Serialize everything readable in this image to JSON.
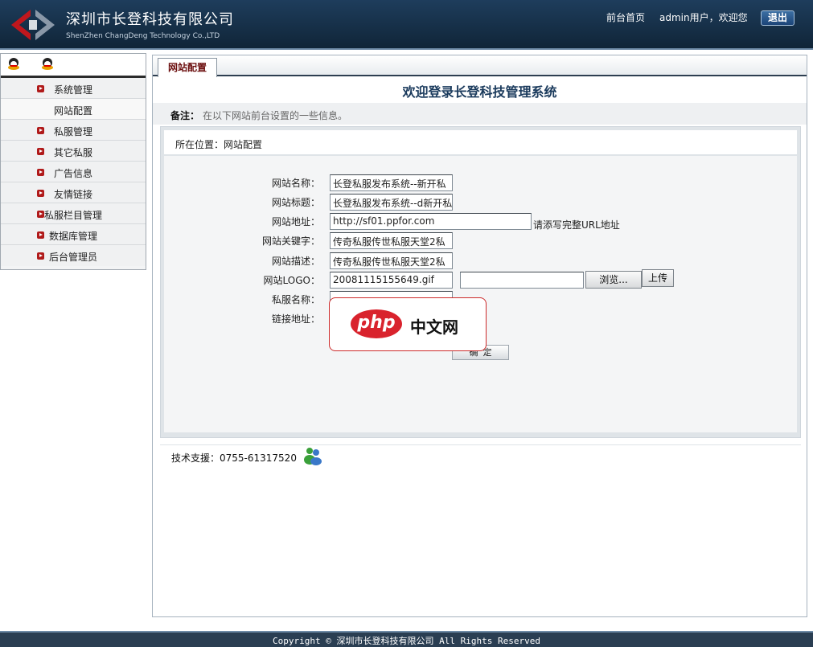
{
  "header": {
    "company_name": "深圳市长登科技有限公司",
    "company_en": "ShenZhen ChangDeng Technology Co.,LTD",
    "nav_home": "前台首页",
    "welcome": "admin用户，欢迎您",
    "logout": "退出"
  },
  "sidebar": {
    "items": [
      {
        "label": "系统管理"
      },
      {
        "label": "网站配置"
      },
      {
        "label": "私服管理"
      },
      {
        "label": "其它私服"
      },
      {
        "label": "广告信息"
      },
      {
        "label": "友情链接"
      },
      {
        "label": "私服栏目管理"
      },
      {
        "label": "数据库管理"
      },
      {
        "label": "后台管理员"
      }
    ]
  },
  "main": {
    "tab": "网站配置",
    "title": "欢迎登录长登科技管理系统",
    "note_label": "备注：",
    "note_text": "在以下网站前台设置的一些信息。",
    "breadcrumb": "所在位置：网站配置",
    "form": {
      "site_name_label": "网站名称：",
      "site_name_value": "长登私服发布系统--新开私",
      "site_title_label": "网站标题：",
      "site_title_value": "长登私服发布系统--d新开私",
      "site_url_label": "网站地址：",
      "site_url_value": "http://sf01.ppfor.com",
      "site_url_hint": "请添写完整URL地址",
      "keywords_label": "网站关键字：",
      "keywords_value": "传奇私服传世私服天堂2私",
      "desc_label": "网站描述：",
      "desc_value": "传奇私服传世私服天堂2私",
      "logo_label": "网站LOGO：",
      "logo_value": "20081115155649.gif",
      "file_value": "",
      "browse_label": "浏览...",
      "upload_label": "上传",
      "server_name_label": "私服名称：",
      "server_name_value": "",
      "link_label": "链接地址：",
      "submit_label": "确定"
    },
    "watermark": {
      "oval": "php",
      "text": "中文网"
    },
    "support": "技术支援：0755-61317520"
  },
  "footer": {
    "copyright": "Copyright © 深圳市长登科技有限公司 All Rights Reserved"
  }
}
